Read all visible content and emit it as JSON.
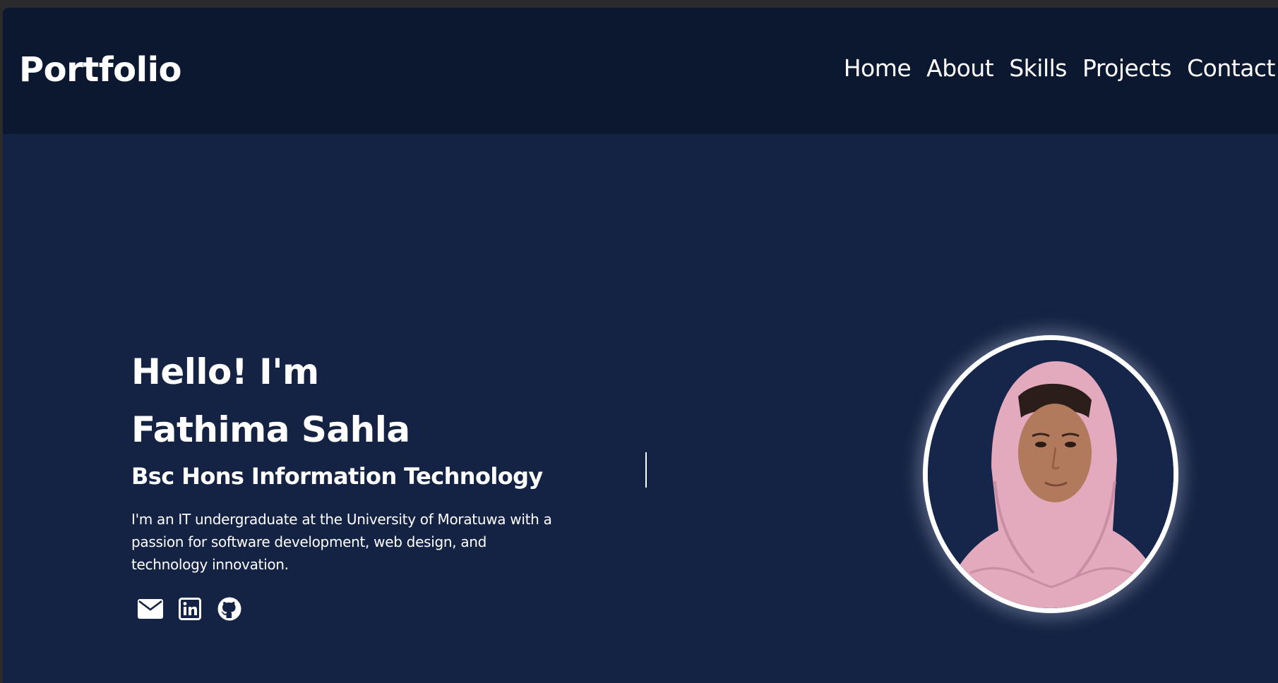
{
  "navbar": {
    "brand": "Portfolio",
    "links": [
      {
        "label": "Home"
      },
      {
        "label": "About"
      },
      {
        "label": "Skills"
      },
      {
        "label": "Projects"
      },
      {
        "label": "Contact"
      }
    ]
  },
  "hero": {
    "greeting": "Hello! I'm",
    "name": "Fathima Sahla",
    "role": "Bsc Hons Information Technology",
    "bio": "I'm an IT undergraduate at the University of Moratuwa with a passion for software development, web design, and technology innovation.",
    "socials": [
      {
        "icon": "envelope-icon"
      },
      {
        "icon": "linkedin-icon"
      },
      {
        "icon": "github-icon"
      }
    ],
    "photo_icon": "profile-photo"
  },
  "colors": {
    "navbar_bg": "#0b1830",
    "page_bg": "#142243",
    "text": "#ffffff",
    "hijab": "#e3a9bd",
    "frame": "#ffffff"
  }
}
